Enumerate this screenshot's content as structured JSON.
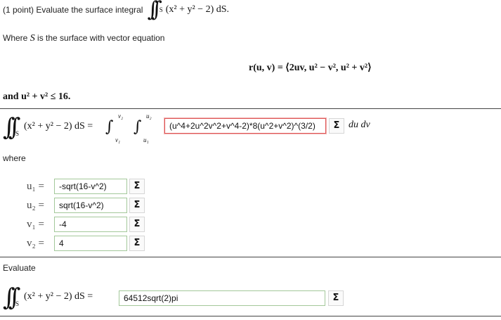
{
  "header": {
    "points": "(1 point) Evaluate the surface integral",
    "integrand": "(x² + y² − 2) dS."
  },
  "surface": {
    "where_text": "Where",
    "S": "S",
    "rest": "is the surface with vector equation",
    "vector_eq": "r(u, v) = ⟨2uv, u² − v², u² + v²⟩"
  },
  "domain": {
    "text": "and u² + v² ≤ 16."
  },
  "integral_setup": {
    "lhs": "(x² + y² − 2) dS =",
    "upper_outer": "v₂",
    "lower_outer": "v₁",
    "upper_inner": "u₂",
    "lower_inner": "u₁",
    "integrand_value": "(u^4+2u^2v^2+v^4-2)*8(u^2+v^2)^(3/2)",
    "du_dv": "du dv"
  },
  "where_label": "where",
  "bounds": [
    {
      "label": "u₁ =",
      "value": "-sqrt(16-v^2)"
    },
    {
      "label": "u₂ =",
      "value": "sqrt(16-v^2)"
    },
    {
      "label": "v₁ =",
      "value": "-4"
    },
    {
      "label": "v₂ =",
      "value": "4"
    }
  ],
  "evaluate_label": "Evaluate",
  "final": {
    "lhs": "(x² + y² − 2) dS =",
    "answer": "64512sqrt(2)pi"
  },
  "icons": {
    "sigma": "Σ",
    "integral": "∫∫",
    "single_integral": "∫"
  },
  "colors": {
    "input_border_ok": "#a3c89a",
    "input_border_error": "#dd5555"
  }
}
